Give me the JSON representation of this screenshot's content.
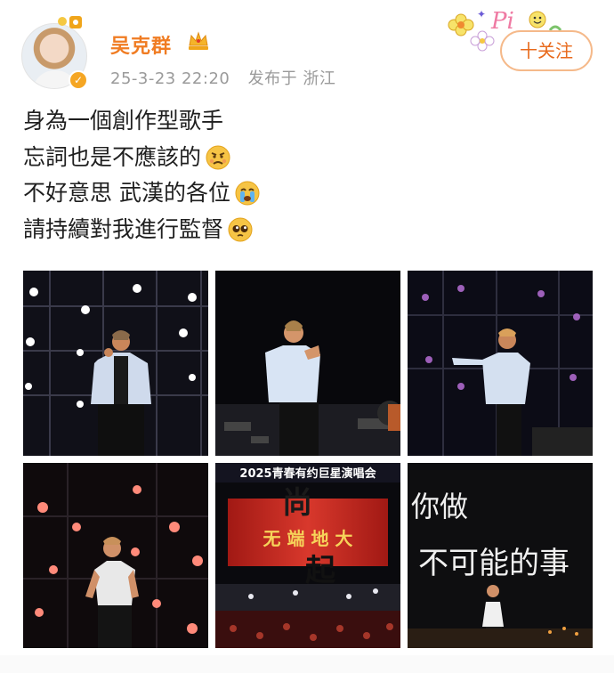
{
  "post": {
    "author": "吴克群",
    "date": "25-3-23 22:20",
    "location": "发布于 浙江",
    "follow_label": "十关注",
    "lines": [
      {
        "text": "身為一個創作型歌手",
        "emoji": ""
      },
      {
        "text": "忘詞也是不應該的",
        "emoji": "angry-emoji"
      },
      {
        "text": "不好意思 武漢的各位",
        "emoji": "crying-emoji"
      },
      {
        "text": "請持續對我進行監督",
        "emoji": "pleading-emoji"
      }
    ]
  },
  "photos": {
    "p5_banner_title": "2025青春有约巨星演唱会",
    "p5_banner_text": "无 端 地 大",
    "p5_big_text_1": "尚",
    "p5_big_text_2": "起",
    "p6_text_1": "你做",
    "p6_text_2": "不可能的事"
  },
  "colors": {
    "username": "#f07c22",
    "meta": "#9a9a9a",
    "follow_border": "#f5b98a",
    "follow_text": "#e86a1c",
    "stage_bg": "#0d0d12",
    "banner_red": "#c8281e"
  }
}
